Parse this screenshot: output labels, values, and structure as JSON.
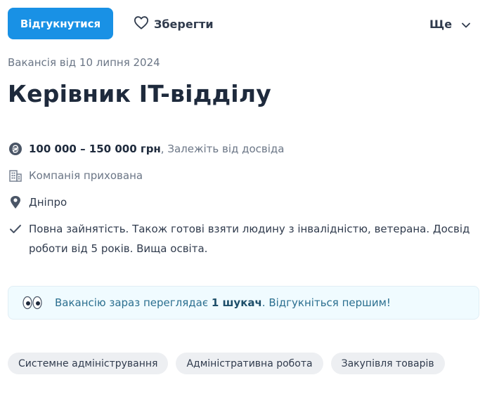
{
  "actions": {
    "apply_label": "Відгукнутися",
    "save_label": "Зберегти",
    "more_label": "Ще"
  },
  "vacancy": {
    "posted": "Вакансія від 10 липня 2024",
    "title": "Керівник IT-відділу",
    "salary_amount": "100 000 – 150 000 грн",
    "salary_note": ", Залежіть від досвіда",
    "company": "Компанія прихована",
    "city": "Дніпро",
    "details": "Повна зайнятість. Також готові взяти людину з інвалідністю, ветерана. Досвід роботи від 5 років. Вища освіта."
  },
  "banner": {
    "prefix": "Вакансію зараз переглядає ",
    "highlight": "1 шукач",
    "suffix": ". Відгукніться першим!"
  },
  "tags": [
    "Системне адміністрування",
    "Адміністративна робота",
    "Закупівля товарів"
  ],
  "icons": {
    "salary": "hryvnia-coin-icon",
    "company": "building-icon",
    "city": "location-pin-icon",
    "details": "checkmark-icon",
    "banner": "eyes-icon",
    "save": "heart-icon",
    "more": "chevron-down-icon"
  },
  "colors": {
    "accent": "#1991e5",
    "title": "#1e2a3c",
    "banner_bg": "#f0fbff",
    "tag_bg": "#edeff2"
  }
}
